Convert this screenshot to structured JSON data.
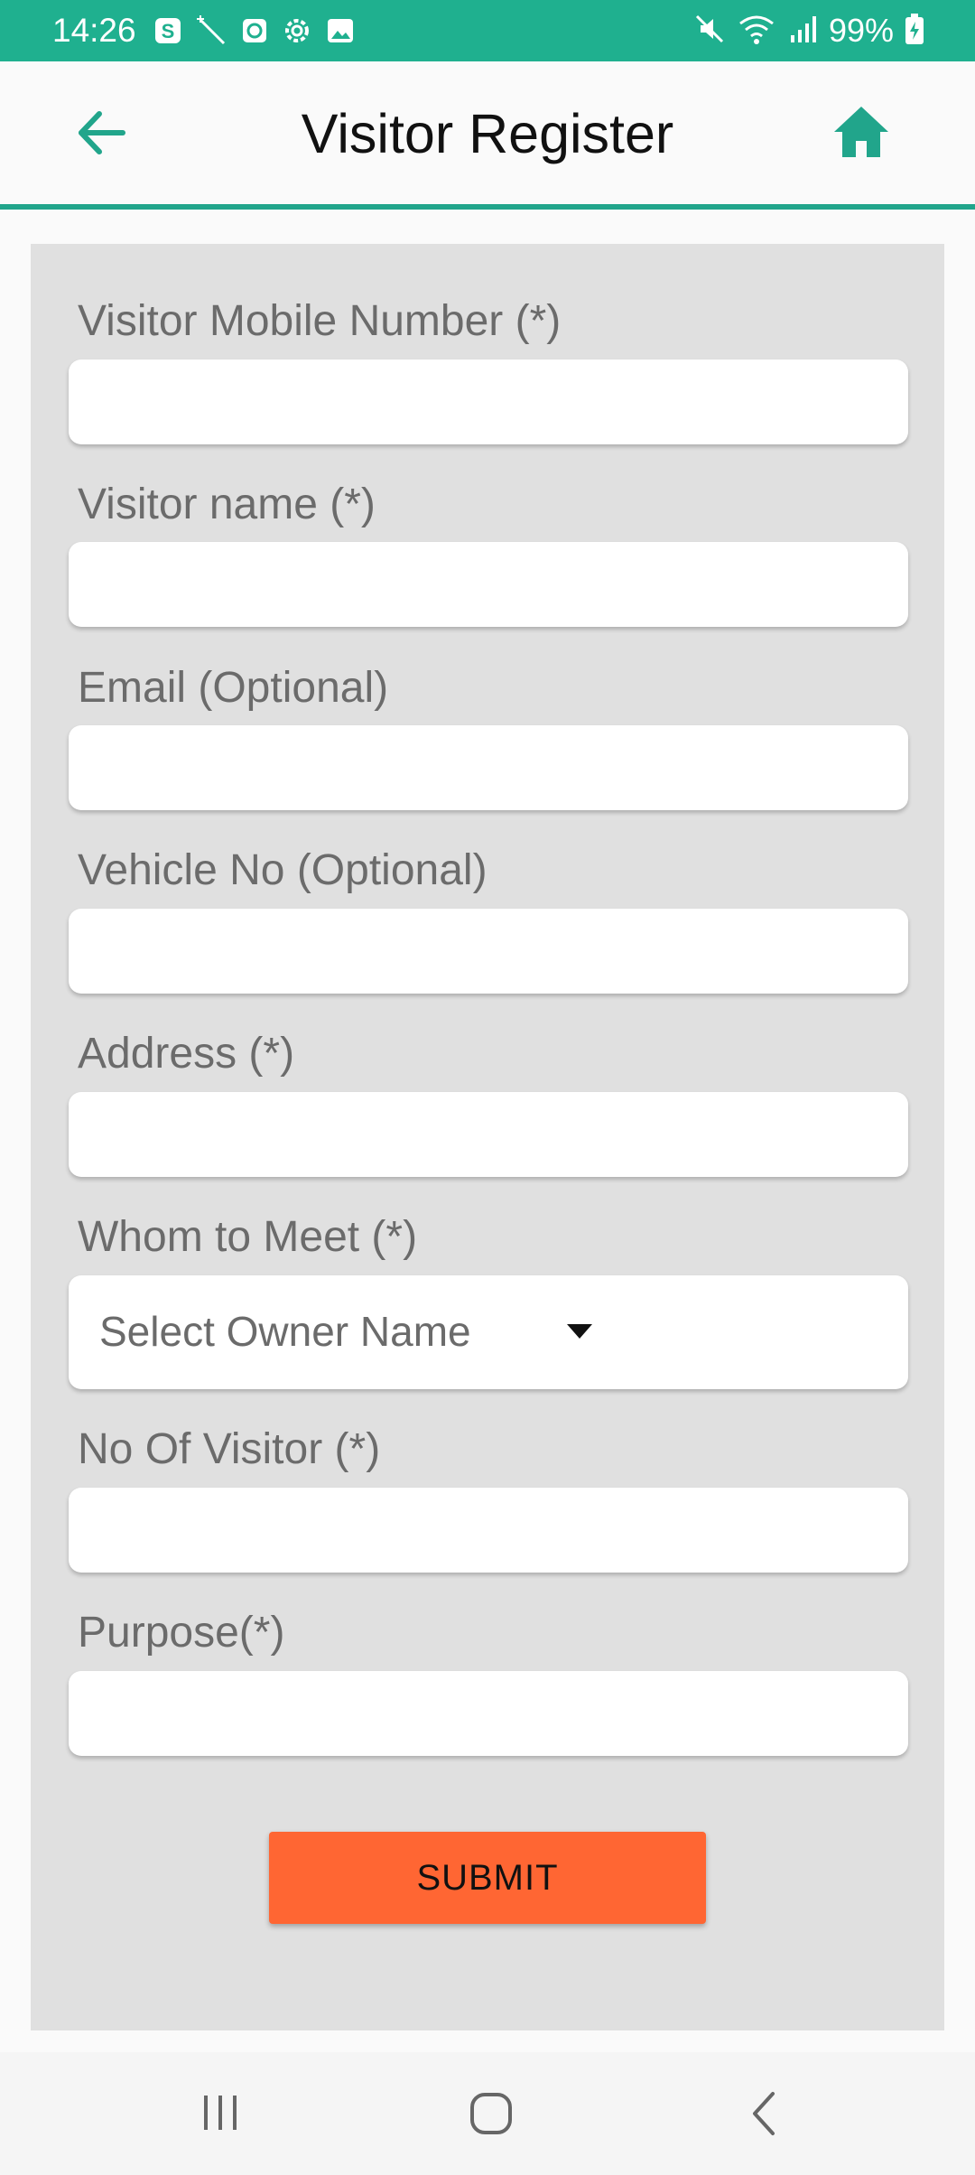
{
  "status_bar": {
    "time": "14:26",
    "battery": "99%",
    "left_icons": [
      "s-app-icon",
      "magic-wand-icon",
      "clock-app-icon",
      "settings-icon",
      "gallery-icon"
    ],
    "right_icons": [
      "mute-icon",
      "wifi-icon",
      "signal-icon",
      "battery-charging-icon"
    ],
    "color": "#1fb08f"
  },
  "app_bar": {
    "title": "Visitor Register",
    "accent": "#21a58b"
  },
  "form": {
    "fields": [
      {
        "label": "Visitor Mobile Number (*)",
        "value": ""
      },
      {
        "label": "Visitor name (*)",
        "value": ""
      },
      {
        "label": "Email (Optional)",
        "value": ""
      },
      {
        "label": "Vehicle No (Optional)",
        "value": ""
      },
      {
        "label": "Address (*)",
        "value": ""
      },
      {
        "label": "Whom to Meet (*)",
        "selected": "Select Owner Name"
      },
      {
        "label": "No Of Visitor (*)",
        "value": ""
      },
      {
        "label": "Purpose(*)",
        "value": ""
      }
    ],
    "submit_label": "SUBMIT",
    "submit_color": "#ff6633"
  },
  "nav_bar": {
    "buttons": [
      "recent-apps-icon",
      "home-nav-icon",
      "back-nav-icon"
    ]
  }
}
